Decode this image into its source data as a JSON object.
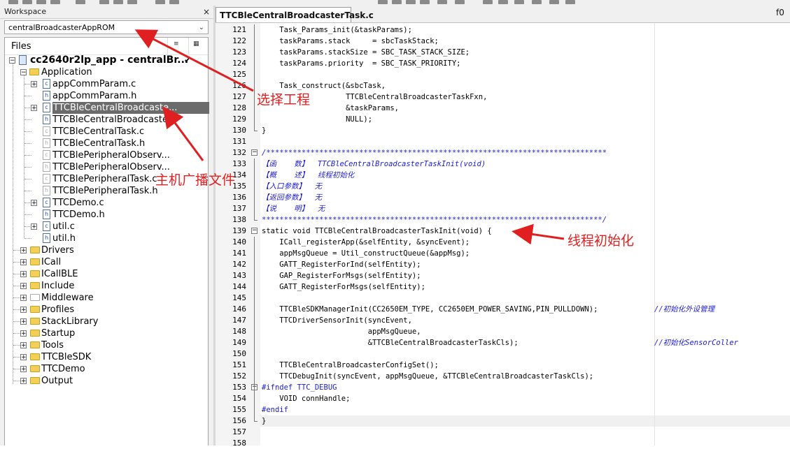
{
  "workspace": {
    "title": "Workspace",
    "close": "×",
    "project_select": "centralBroadcasterAppROM",
    "files_header": "Files"
  },
  "tree": {
    "root": "cc2640r2lp_app - centralBr...",
    "application": "Application",
    "app_items": [
      "appCommParam.c",
      "appCommParam.h",
      "TTCBleCentralBroadcaste...",
      "TTCBleCentralBroadcaste...",
      "TTCBleCentralTask.c",
      "TTCBleCentralTask.h",
      "TTCBlePeripheralObserv...",
      "TTCBlePeripheralObserv...",
      "TTCBlePeripheralTask.c",
      "TTCBlePeripheralTask.h",
      "TTCDemo.c",
      "TTCDemo.h",
      "util.c",
      "util.h"
    ],
    "groups": [
      "Drivers",
      "ICall",
      "ICallBLE",
      "Include",
      "Middleware",
      "Profiles",
      "StackLibrary",
      "Startup",
      "Tools",
      "TTCBleSDK",
      "TTCDemo",
      "Output"
    ]
  },
  "editor": {
    "tab": "TTCBleCentralBroadcasterTask.c",
    "function_label": "f0",
    "lines": [
      {
        "n": "121",
        "t": "    Task_Params_init(&taskParams);"
      },
      {
        "n": "122",
        "t": "    taskParams.stack     = sbcTaskStack;"
      },
      {
        "n": "123",
        "t": "    taskParams.stackSize = SBC_TASK_STACK_SIZE;"
      },
      {
        "n": "124",
        "t": "    taskParams.priority  = SBC_TASK_PRIORITY;"
      },
      {
        "n": "125",
        "t": ""
      },
      {
        "n": "126",
        "t": "    Task_construct(&sbcTask,"
      },
      {
        "n": "127",
        "t": "                   TTCBleCentralBroadcasterTaskFxn,"
      },
      {
        "n": "128",
        "t": "                   &taskParams,"
      },
      {
        "n": "129",
        "t": "                   NULL);"
      },
      {
        "n": "130",
        "t": "}"
      },
      {
        "n": "131",
        "t": ""
      },
      {
        "n": "132",
        "t": "/*****************************************************************************"
      },
      {
        "n": "133",
        "t": "【函    数】  TTCBleCentralBroadcasterTaskInit(void)"
      },
      {
        "n": "134",
        "t": "【概    述】  线程初始化"
      },
      {
        "n": "135",
        "t": "【入口参数】  无"
      },
      {
        "n": "136",
        "t": "【返回参数】  无"
      },
      {
        "n": "137",
        "t": "【说    明】  无"
      },
      {
        "n": "138",
        "t": "*****************************************************************************/"
      },
      {
        "n": "139",
        "t": "static void TTCBleCentralBroadcasterTaskInit(void) {"
      },
      {
        "n": "140",
        "t": "    ICall_registerApp(&selfEntity, &syncEvent);"
      },
      {
        "n": "141",
        "t": "    appMsgQueue = Util_constructQueue(&appMsg);"
      },
      {
        "n": "142",
        "t": "    GATT_RegisterForInd(selfEntity);"
      },
      {
        "n": "143",
        "t": "    GAP_RegisterForMsgs(selfEntity);"
      },
      {
        "n": "144",
        "t": "    GATT_RegisterForMsgs(selfEntity);"
      },
      {
        "n": "145",
        "t": ""
      },
      {
        "n": "146",
        "t": "    TTCBleSDKManagerInit(CC2650EM_TYPE, CC2650EM_POWER_SAVING,PIN_PULLDOWN);"
      },
      {
        "n": "147",
        "t": "    TTCDriverSensorInit(syncEvent,"
      },
      {
        "n": "148",
        "t": "                        appMsgQueue,"
      },
      {
        "n": "149",
        "t": "                        &TTCBleCentralBroadcasterTaskCls);"
      },
      {
        "n": "150",
        "t": ""
      },
      {
        "n": "151",
        "t": "    TTCBleCentralBroadcasterConfigSet();"
      },
      {
        "n": "152",
        "t": "    TTCDebugInit(syncEvent, appMsgQueue, &TTCBleCentralBroadcasterTaskCls);"
      },
      {
        "n": "153",
        "t": "#ifndef TTC_DEBUG"
      },
      {
        "n": "154",
        "t": "    VOID connHandle;"
      },
      {
        "n": "155",
        "t": "#endif"
      },
      {
        "n": "156",
        "t": "}"
      },
      {
        "n": "157",
        "t": ""
      },
      {
        "n": "158",
        "t": ""
      }
    ],
    "comment_146": "//初始化外设管理",
    "comment_149": "//初始化SensorColler"
  },
  "annotations": {
    "select_project": "选择工程",
    "broadcast_file": "主机广播文件",
    "thread_init": "线程初始化"
  },
  "colors": {
    "annotation": "#e02020",
    "comment": "#1c1cd4",
    "selection": "#6b6b6b"
  }
}
